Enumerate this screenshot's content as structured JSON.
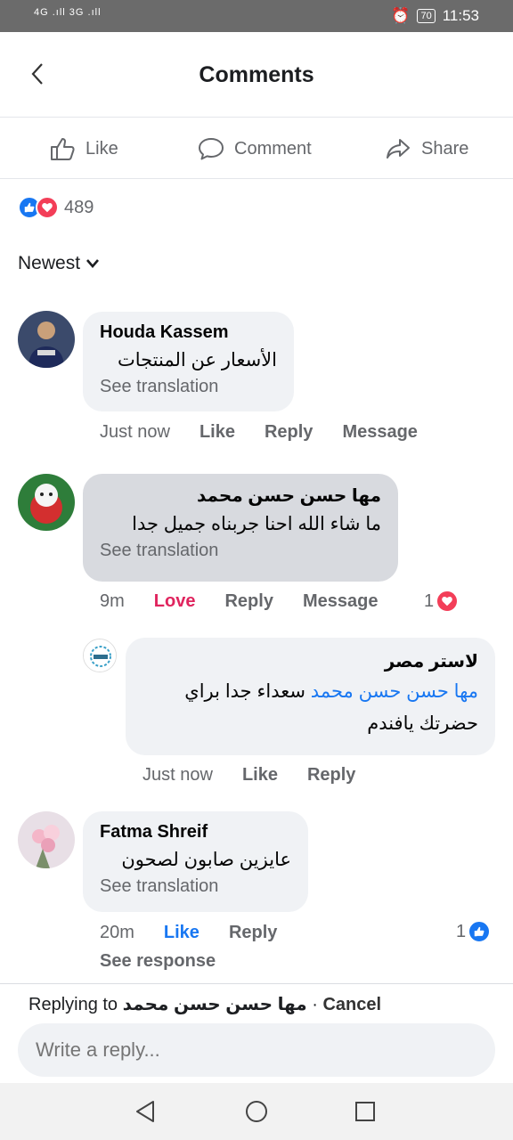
{
  "status": {
    "network": "4G .ıll 3G .ıll",
    "battery": "70",
    "time": "11:53"
  },
  "header": {
    "title": "Comments",
    "back_icon": "chevron-left-icon"
  },
  "actions": {
    "like": "Like",
    "comment": "Comment",
    "share": "Share"
  },
  "reactions": {
    "count": "489"
  },
  "sort": {
    "label": "Newest"
  },
  "comments": [
    {
      "author": "Houda Kassem",
      "text": "الأسعار عن المنتجات",
      "see_translation": "See translation",
      "time": "Just now",
      "like": "Like",
      "reply": "Reply",
      "message": "Message"
    },
    {
      "author": "مها حسن حسن محمد",
      "text": "ما شاء الله احنا جربناه جميل جدا",
      "see_translation": "See translation",
      "time": "9m",
      "like": "Love",
      "reply": "Reply",
      "message": "Message",
      "react_count": "1"
    },
    {
      "author": "Fatma Shreif",
      "text": "عايزين صابون لصحون",
      "see_translation": "See translation",
      "time": "20m",
      "like": "Like",
      "reply": "Reply",
      "react_count": "1",
      "see_response": "See response"
    }
  ],
  "reply": {
    "author": "لاستر مصر",
    "mention": "مها حسن حسن محمد",
    "text": "سعداء جدا براي حضرتك يافندم",
    "time": "Just now",
    "like": "Like",
    "reply": "Reply"
  },
  "reply_bar": {
    "replying_to": "Replying to",
    "name": "مها حسن حسن محمد",
    "separator": " · ",
    "cancel": "Cancel",
    "placeholder": "Write a reply..."
  },
  "colors": {
    "accent": "#1877f2",
    "love": "#f33e58",
    "bubble": "#f0f2f5"
  }
}
